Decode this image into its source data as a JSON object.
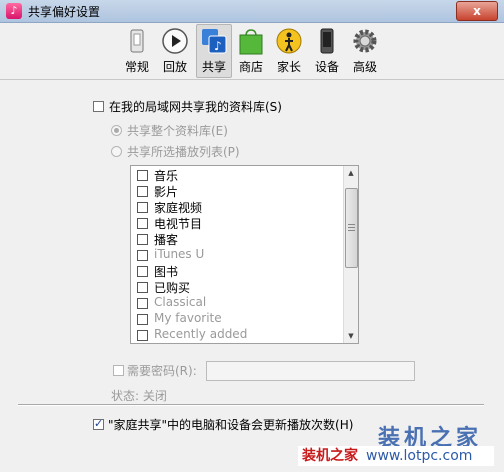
{
  "window": {
    "title": "共享偏好设置",
    "close_label": "x"
  },
  "toolbar": {
    "items": [
      {
        "label": "常规",
        "icon": "general-icon"
      },
      {
        "label": "回放",
        "icon": "playback-icon"
      },
      {
        "label": "共享",
        "icon": "sharing-icon",
        "selected": true
      },
      {
        "label": "商店",
        "icon": "store-icon"
      },
      {
        "label": "家长",
        "icon": "parental-icon"
      },
      {
        "label": "设备",
        "icon": "devices-icon"
      },
      {
        "label": "高级",
        "icon": "advanced-icon"
      }
    ]
  },
  "sharing": {
    "share_library_label": "在我的局域网共享我的资料库(S)",
    "share_library_checked": false,
    "entire_library_label": "共享整个资料库(E)",
    "selected_playlists_label": "共享所选播放列表(P)",
    "list_items": [
      "音乐",
      "影片",
      "家庭视频",
      "电视节目",
      "播客",
      "iTunes U",
      "图书",
      "已购买",
      "Classical",
      "My favorite",
      "Recently added"
    ],
    "require_password_label": "需要密码(R):",
    "password_value": "",
    "status_label": "状态: 关闭",
    "home_sharing_label": "\"家庭共享\"中的电脑和设备会更新播放次数(H)",
    "home_sharing_checked": true
  },
  "watermark": {
    "line1": "装机之家",
    "line2_cn": "装机之家",
    "line2_url": "www.lotpc.com"
  },
  "colors": {
    "accent_blue": "#2d5aa8",
    "watermark_red": "#c81b1b"
  }
}
